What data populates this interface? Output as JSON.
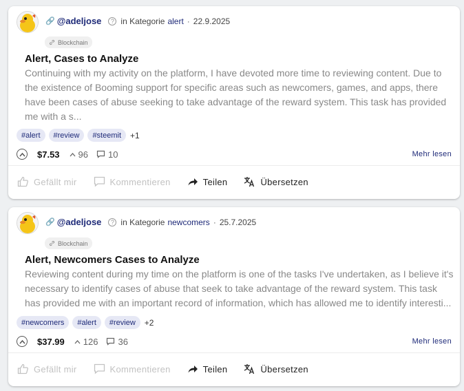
{
  "posts": [
    {
      "author": "@adeljose",
      "category_prefix": "in Kategorie",
      "category": "alert",
      "date": "22.9.2025",
      "community": "Blockchain",
      "title": "Alert, Cases to Analyze",
      "excerpt": "Continuing with my activity on the platform, I have devoted more time to reviewing content. Due to the existence of Booming support for specific areas such as newcomers, games, and apps, there have been cases of abuse seeking to take advantage of the reward system. This task has provided me with a s...",
      "tags": [
        "#alert",
        "#review",
        "#steemit"
      ],
      "more_tags": "+1",
      "payout": "$7.53",
      "votes": "96",
      "comments": "10",
      "read_more": "Mehr lesen"
    },
    {
      "author": "@adeljose",
      "category_prefix": "in Kategorie",
      "category": "newcomers",
      "date": "25.7.2025",
      "community": "Blockchain",
      "title": "Alert, Newcomers Cases to Analyze",
      "excerpt": "Reviewing content during my time on the platform is one of the tasks I've undertaken, as I believe it's necessary to identify cases of abuse that seek to take advantage of the reward system. This task has provided me with an important record of information, which has allowed me to identify interesti...",
      "tags": [
        "#newcomers",
        "#alert",
        "#review"
      ],
      "more_tags": "+2",
      "payout": "$37.99",
      "votes": "126",
      "comments": "36",
      "read_more": "Mehr lesen"
    }
  ],
  "actions": {
    "like": "Gefällt mir",
    "comment": "Kommentieren",
    "share": "Teilen",
    "translate": "Übersetzen"
  },
  "icons": {
    "link": "link-icon",
    "help": "help-circle-icon",
    "community": "chain-icon",
    "vote": "upvote-circle-icon",
    "votes": "caret-up-icon",
    "comments": "comment-icon",
    "like": "thumbs-up-icon",
    "comment": "comment-bubble-icon",
    "share": "share-arrow-icon",
    "translate": "translate-icon"
  },
  "colors": {
    "accent": "#1e2a78",
    "tag_bg": "#e6e8f5",
    "muted": "#888888",
    "disabled": "#c2c2c2"
  }
}
